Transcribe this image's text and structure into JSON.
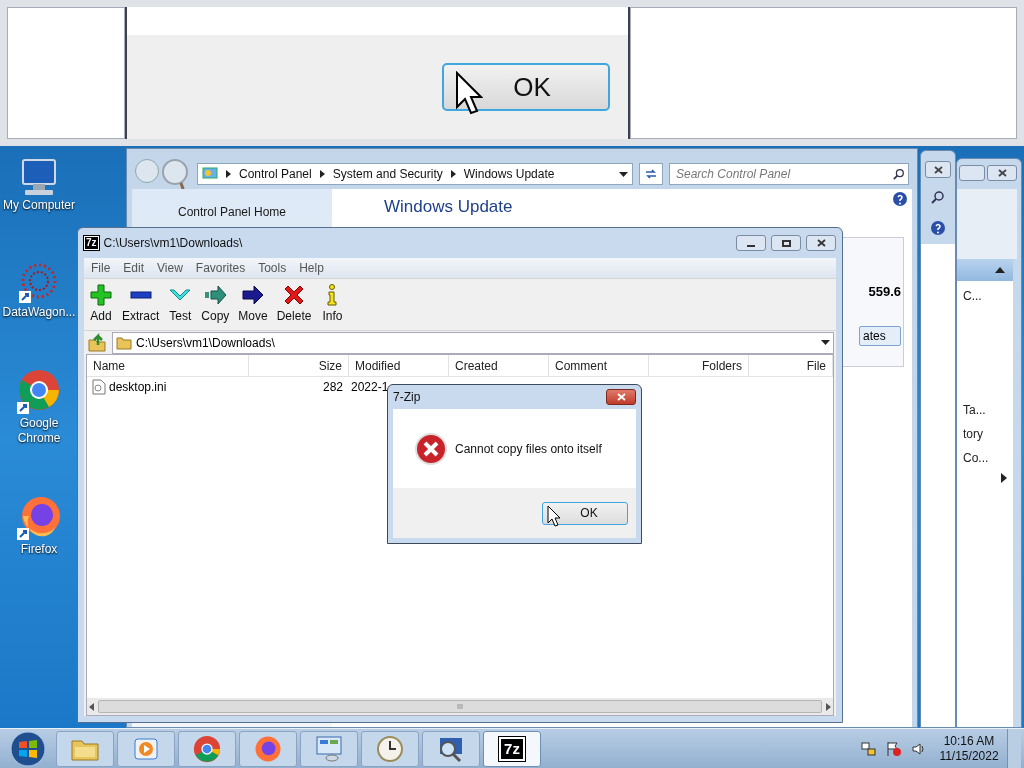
{
  "magnified_view": {
    "button": "OK"
  },
  "desktop_icons": [
    {
      "label": "My Computer",
      "kind": "computer"
    },
    {
      "label": "DataWagon...",
      "kind": "app"
    },
    {
      "label": "Google Chrome",
      "kind": "chrome"
    },
    {
      "label": "Firefox",
      "kind": "firefox"
    }
  ],
  "control_panel": {
    "breadcrumb": [
      "Control Panel",
      "System and Security",
      "Windows Update"
    ],
    "search": {
      "placeholder": "Search Control Panel"
    },
    "nav_link": "Control Panel Home",
    "heading": "Windows Update",
    "value": "559.6",
    "button": "ates"
  },
  "back_window": {
    "items": [
      {
        "label": "C...",
        "kind": "text"
      },
      {
        "label": "Ta...",
        "kind": "text"
      },
      {
        "label": "tory",
        "kind": "text"
      },
      {
        "label": "Co...",
        "kind": "text"
      },
      {
        "kind": "arrow"
      }
    ]
  },
  "seven_zip": {
    "title": "C:\\Users\\vm1\\Downloads\\",
    "logo": "7z",
    "menu": [
      "File",
      "Edit",
      "View",
      "Favorites",
      "Tools",
      "Help"
    ],
    "toolbar": [
      {
        "label": "Add",
        "kind": "add"
      },
      {
        "label": "Extract",
        "kind": "extract"
      },
      {
        "label": "Test",
        "kind": "test"
      },
      {
        "label": "Copy",
        "kind": "copy"
      },
      {
        "label": "Move",
        "kind": "move"
      },
      {
        "label": "Delete",
        "kind": "delete"
      },
      {
        "label": "Info",
        "kind": "info"
      }
    ],
    "address": "C:\\Users\\vm1\\Downloads\\",
    "columns": [
      "Name",
      "Size",
      "Modified",
      "Created",
      "Comment",
      "Folders",
      "File"
    ],
    "rows": [
      {
        "name": "desktop.ini",
        "size": "282",
        "modified": "2022-1"
      }
    ],
    "scroll_grip": "III"
  },
  "dialog": {
    "title": "7-Zip",
    "message": "Cannot copy files onto itself",
    "button": "OK"
  },
  "taskbar": {
    "items": [
      {
        "kind": "explorer",
        "selected": false
      },
      {
        "kind": "media",
        "selected": false
      },
      {
        "kind": "chrome",
        "selected": false
      },
      {
        "kind": "firefox",
        "selected": false
      },
      {
        "kind": "control",
        "selected": false
      },
      {
        "kind": "clock",
        "selected": false
      },
      {
        "kind": "magnifier",
        "selected": false
      },
      {
        "kind": "sevenzip",
        "label": "7z",
        "selected": true
      }
    ],
    "time": "10:16 AM",
    "date": "11/15/2022"
  }
}
